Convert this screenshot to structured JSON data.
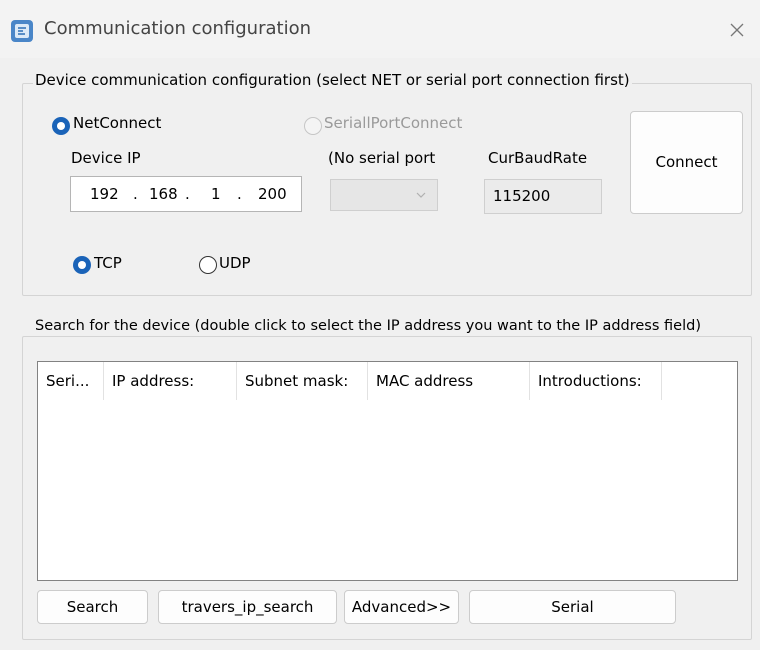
{
  "window": {
    "title": "Communication configuration",
    "icon": "app-icon",
    "close_icon": "close-icon"
  },
  "device_group": {
    "label": "Device communication configuration (select NET or serial port connection first)",
    "net_connect": {
      "label": "NetConnect",
      "selected": true
    },
    "serial_connect": {
      "label": "SeriallPortConnect",
      "selected": false,
      "enabled": false
    },
    "device_ip_label": "Device IP",
    "ip": {
      "o1": "192",
      "o2": "168",
      "o3": "1",
      "o4": "200",
      "dot": "."
    },
    "serial_port_label": "(No serial port",
    "serial_port_value": "",
    "baud_label": "CurBaudRate",
    "baud_value": "115200",
    "connect_button": "Connect",
    "tcp": {
      "label": "TCP",
      "selected": true
    },
    "udp": {
      "label": "UDP",
      "selected": false
    }
  },
  "search_group": {
    "label": "Search for the device (double click to select the IP address you want to the IP address field)",
    "columns": [
      "Seri...",
      "IP address:",
      "Subnet mask:",
      "MAC address",
      "Introductions:"
    ],
    "rows": []
  },
  "buttons": {
    "search": "Search",
    "travers": "travers_ip_search",
    "advanced": "Advanced>>",
    "serial": "Serial"
  },
  "colors": {
    "accent": "#1a63b8",
    "window_bg": "#f0f0f0",
    "group_border": "#d4d4d4"
  }
}
